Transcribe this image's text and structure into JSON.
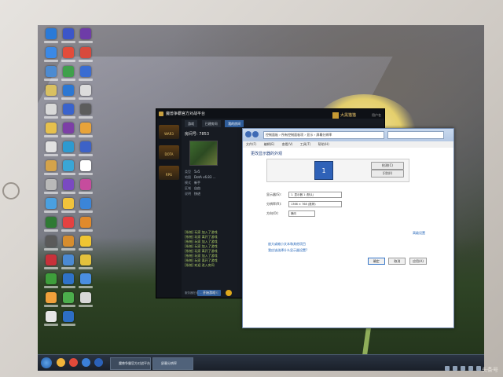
{
  "desktop": {
    "icon_colors": [
      [
        "#2a7ad8",
        "#3b89e6",
        "#4d8bd1",
        "#d9c061",
        "#d9d9d9",
        "#e6c04d",
        "#e1e1e1",
        "#d4a34a",
        "#b9b9b9",
        "#4aa0e0",
        "#2f7a34",
        "#5a5a5a",
        "#c7313a",
        "#3e9e3b",
        "#f0a13b",
        "#e6e6e6"
      ],
      [
        "#3c56c9",
        "#e34c3a",
        "#3fa04b",
        "#2c77d3",
        "#3a63cc",
        "#7c3fa6",
        "#2e9ad0",
        "#3aa6d6",
        "#7a4ac2",
        "#f0c23b",
        "#e44141",
        "#d68d2e",
        "#4b8ad2",
        "#2f72c8",
        "#4cae4c",
        "#2d6ec4"
      ],
      [
        "#6e3ca8",
        "#d84a3c",
        "#3a6cd2",
        "#dcdcdc",
        "#5c5c5c",
        "#e8a33a",
        "#3d62c7",
        "#ffffff",
        "#c64c9d",
        "#3b85d8",
        "#e08a2c",
        "#f0c532",
        "#e3c13d",
        "#4a8ee0",
        "#d8d8d8"
      ]
    ]
  },
  "game_window": {
    "title": "魔兽争霸官方对战平台",
    "user_name": "大黑猫猫",
    "right_text": "用户名",
    "nav_items": [
      "WAR3",
      "DOTA",
      "RPG"
    ],
    "tabs": [
      "游戏",
      "已建房间",
      "我的房间"
    ],
    "room_title": "房间号: 7853",
    "info": [
      {
        "k": "类型",
        "v": "5v5"
      },
      {
        "k": "地图",
        "v": "DotA v6.83 …"
      },
      {
        "k": "模式",
        "v": "新手"
      },
      {
        "k": "区域",
        "v": "自由"
      },
      {
        "k": "说明",
        "v": "快进"
      }
    ],
    "chat_lines": [
      "[系统] 玩家 加入了游戏",
      "[系统] 玩家 离开了游戏",
      "[系统] 玩家 加入了游戏",
      "[系统] 玩家 加入了游戏",
      "[系统] 玩家 离开了游戏",
      "[系统] 玩家 加入了游戏",
      "[系统] 玩家 离开了游戏",
      "[系统] 欢迎 进入房间"
    ],
    "start_button": "开始游戏",
    "status": "服务器在线 … 版本 … 帮助"
  },
  "control_panel": {
    "address": "控制面板 › 所有控制面板项 › 显示 › 屏幕分辨率",
    "menu": [
      "文件(F)",
      "编辑(E)",
      "查看(V)",
      "工具(T)",
      "帮助(H)"
    ],
    "heading": "更改显示器的外观",
    "monitor_number": "1",
    "detect_label": "检测(C)",
    "identify_label": "识别(I)",
    "rows": [
      {
        "label": "显示器(S):",
        "value": "1. 显示器 1 (默认)"
      },
      {
        "label": "分辨率(R):",
        "value": "1366 × 768 (推荐)"
      },
      {
        "label": "方向(O):",
        "value": "横向"
      }
    ],
    "advanced_link": "高级设置",
    "links": [
      "放大或缩小文本和其他项目",
      "我应该选择什么显示器设置?"
    ],
    "buttons": {
      "ok": "确定",
      "cancel": "取消",
      "apply": "应用(A)"
    }
  },
  "taskbar": {
    "tasks": [
      "魔兽争霸官方对战平台",
      "屏幕分辨率"
    ]
  },
  "watermark": "头条号"
}
